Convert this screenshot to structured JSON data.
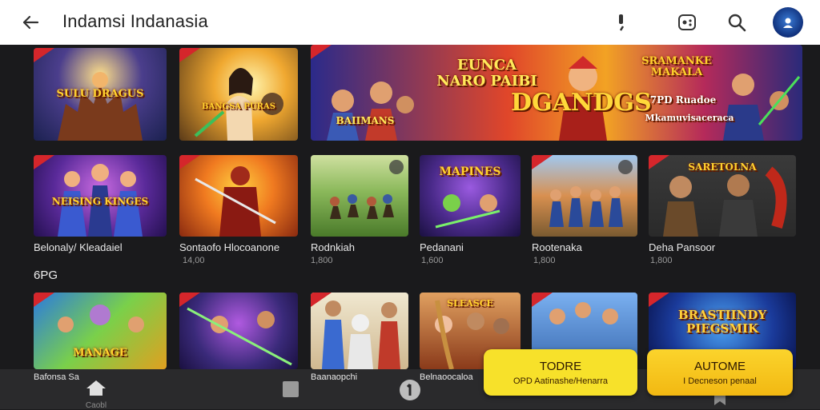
{
  "header": {
    "title": "Indamsi Indanasia",
    "icons": [
      "back-arrow-icon",
      "mic-icon",
      "game-controller-icon",
      "search-icon",
      "avatar"
    ]
  },
  "banner_row": [
    {
      "art": "SULU\nDRAGUS"
    },
    {
      "art": "BANGSA\nPURAS"
    },
    {
      "art_top": "EUNCA\nNARO PAIBI",
      "art_main": "DGANDGS",
      "art_badge": "BAIIMANS",
      "art_side": "SRAMANKE\nMAKALA",
      "art_side2": "7PD Ruadoe",
      "art_side3": "Mkamuvisaceraca"
    }
  ],
  "row2": [
    {
      "art": "NEISING\nKINGES",
      "label": "Belonaly/ Kleadaiel",
      "sub": ""
    },
    {
      "art": "",
      "label": "Sontaofo Hlocoanone",
      "sub": "14,00"
    },
    {
      "art": "",
      "label": "Rodnkiah",
      "sub": "1,800"
    },
    {
      "art": "MAPINES",
      "label": "Pedanani",
      "sub": "1,600"
    },
    {
      "art": "",
      "label": "Rootenaka",
      "sub": "1,800"
    },
    {
      "art": "SARETOLNA",
      "label": "Deha Pansoor",
      "sub": "1,800"
    }
  ],
  "section_title": "6PG",
  "row3": [
    {
      "art": "MANAGE",
      "label": "Bafonsa Sa"
    },
    {
      "art": "",
      "label": ""
    },
    {
      "art": "",
      "label": "Baanaopchi"
    },
    {
      "art": "SLEASCE",
      "label": "Belnaoocaloa"
    },
    {
      "art": "",
      "label": ""
    },
    {
      "art": "BRASTIINDY\nPIEGSMIK",
      "label": ""
    }
  ],
  "cta": [
    {
      "title": "TODRE",
      "subtitle": "OPD Aatinashe/Henarra"
    },
    {
      "title": "AUTOME",
      "subtitle": "I Decneson penaal"
    }
  ],
  "nav": [
    {
      "icon": "home-icon",
      "label": "Caobl"
    },
    {
      "icon": "square-icon",
      "label": ""
    },
    {
      "icon": "info-icon",
      "label": ""
    },
    {
      "icon": "bookmark-icon",
      "label": ""
    }
  ],
  "colors": {
    "badge": "#d5262b",
    "cta_yellow": "#f7e12a",
    "cta_orange": "#f7c21c",
    "bg": "#1a1a1c"
  }
}
